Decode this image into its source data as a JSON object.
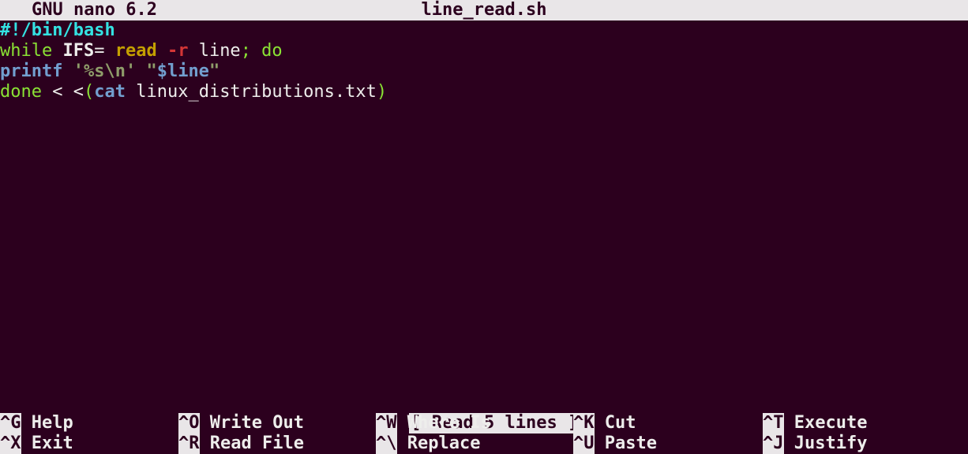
{
  "titlebar": {
    "app": "GNU nano 6.2",
    "filename": "line_read.sh"
  },
  "code": {
    "l1_shebang": "#!/bin/bash",
    "l2_while": "while",
    "l2_ifs": " IFS",
    "l2_eq": "=",
    "l2_read": " read",
    "l2_flag": " -r",
    "l2_line": " line",
    "l2_semi": ";",
    "l2_do": " do",
    "l3_printf": "printf",
    "l3_fmt": " '%s\\n'",
    "l3_space": " ",
    "l3_q1": "\"",
    "l3_var": "$line",
    "l3_q2": "\"",
    "l4_done": "done ",
    "l4_lt": "<",
    "l4_sp": " ",
    "l4_lt2": "<",
    "l4_paren1": "(",
    "l4_cat": "cat",
    "l4_file": " linux_distributions.txt",
    "l4_paren2": ")"
  },
  "status": {
    "text": "[ Read 5 lines ]"
  },
  "shortcuts": {
    "row1": [
      {
        "key": "^G",
        "label": " Help"
      },
      {
        "key": "^O",
        "label": " Write Out"
      },
      {
        "key": "^W",
        "label": " Where Is"
      },
      {
        "key": "^K",
        "label": " Cut"
      },
      {
        "key": "^T",
        "label": " Execute"
      }
    ],
    "row2": [
      {
        "key": "^X",
        "label": " Exit"
      },
      {
        "key": "^R",
        "label": " Read File"
      },
      {
        "key": "^\\",
        "label": " Replace"
      },
      {
        "key": "^U",
        "label": " Paste"
      },
      {
        "key": "^J",
        "label": " Justify"
      }
    ]
  }
}
